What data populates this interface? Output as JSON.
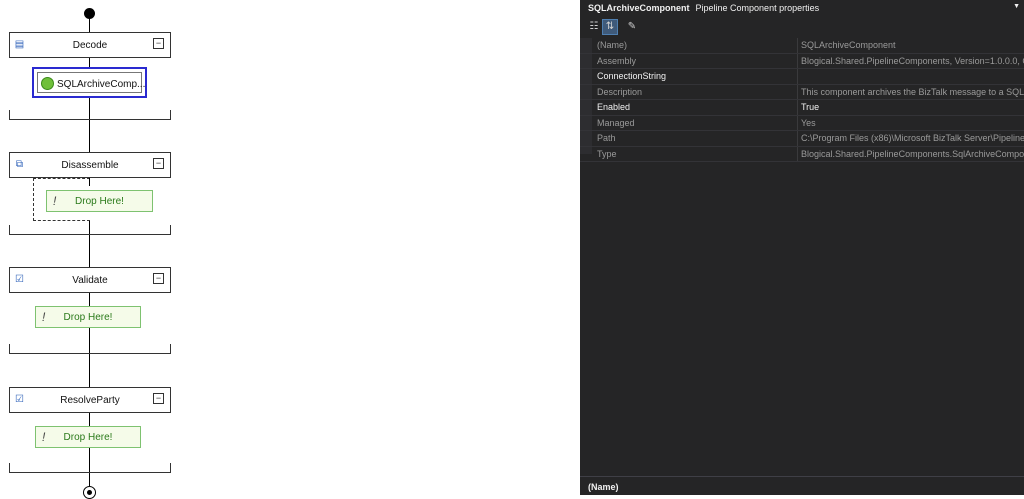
{
  "pipeline": {
    "stages": [
      {
        "title": "Decode",
        "icon": "decode-stage-icon"
      },
      {
        "title": "Disassemble",
        "icon": "disassemble-stage-icon"
      },
      {
        "title": "Validate",
        "icon": "validate-stage-icon"
      },
      {
        "title": "ResolveParty",
        "icon": "resolveparty-stage-icon"
      }
    ],
    "component_label": "SQLArchiveComp...",
    "drop_label": "Drop Here!",
    "collapse_glyph": "−"
  },
  "properties": {
    "title_object": "SQLArchiveComponent",
    "title_kind": "Pipeline Component properties",
    "rows": [
      {
        "name": "(Name)",
        "value": "SQLArchiveComponent"
      },
      {
        "name": "Assembly",
        "value": "Blogical.Shared.PipelineComponents, Version=1.0.0.0, C"
      },
      {
        "name": "ConnectionString",
        "value": ""
      },
      {
        "name": "Description",
        "value": "This component archives the BizTalk message to a SQL d"
      },
      {
        "name": "Enabled",
        "value": "True"
      },
      {
        "name": "Managed",
        "value": "Yes"
      },
      {
        "name": "Path",
        "value": "C:\\Program Files (x86)\\Microsoft BizTalk Server\\Pipeline"
      },
      {
        "name": "Type",
        "value": "Blogical.Shared.PipelineComponents.SqlArchiveCompo"
      }
    ],
    "description_title": "(Name)"
  }
}
